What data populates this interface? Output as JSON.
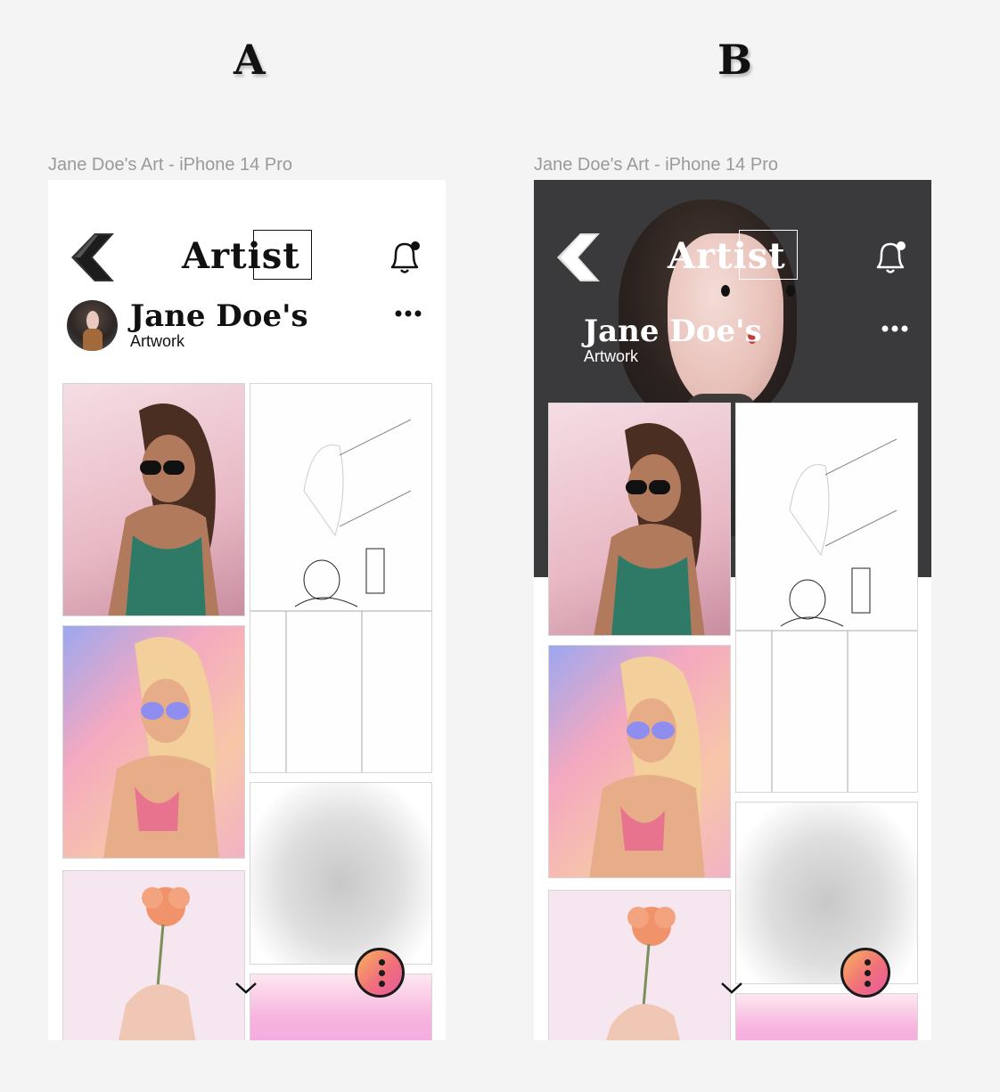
{
  "variants": [
    {
      "label": "A",
      "frame_title": "Jane Doe's Art - iPhone 14 Pro",
      "header": {
        "logo": "Artist"
      },
      "profile": {
        "name": "Jane Doe's",
        "subtitle": "Artwork"
      }
    },
    {
      "label": "B",
      "frame_title": "Jane Doe's Art - iPhone 14 Pro",
      "header": {
        "logo": "Artist"
      },
      "profile": {
        "name": "Jane Doe's",
        "subtitle": "Artwork"
      }
    }
  ],
  "colors": {
    "hero_background": "#3a393b",
    "fab_gradient_start": "#f8b25c",
    "fab_gradient_end": "#e85aa0",
    "text_dark": "#111111",
    "text_light": "#ffffff"
  },
  "icons": [
    "back-chevron-icon",
    "bell-icon",
    "more-dots-icon",
    "chevron-down-icon",
    "vertical-dots-icon"
  ]
}
